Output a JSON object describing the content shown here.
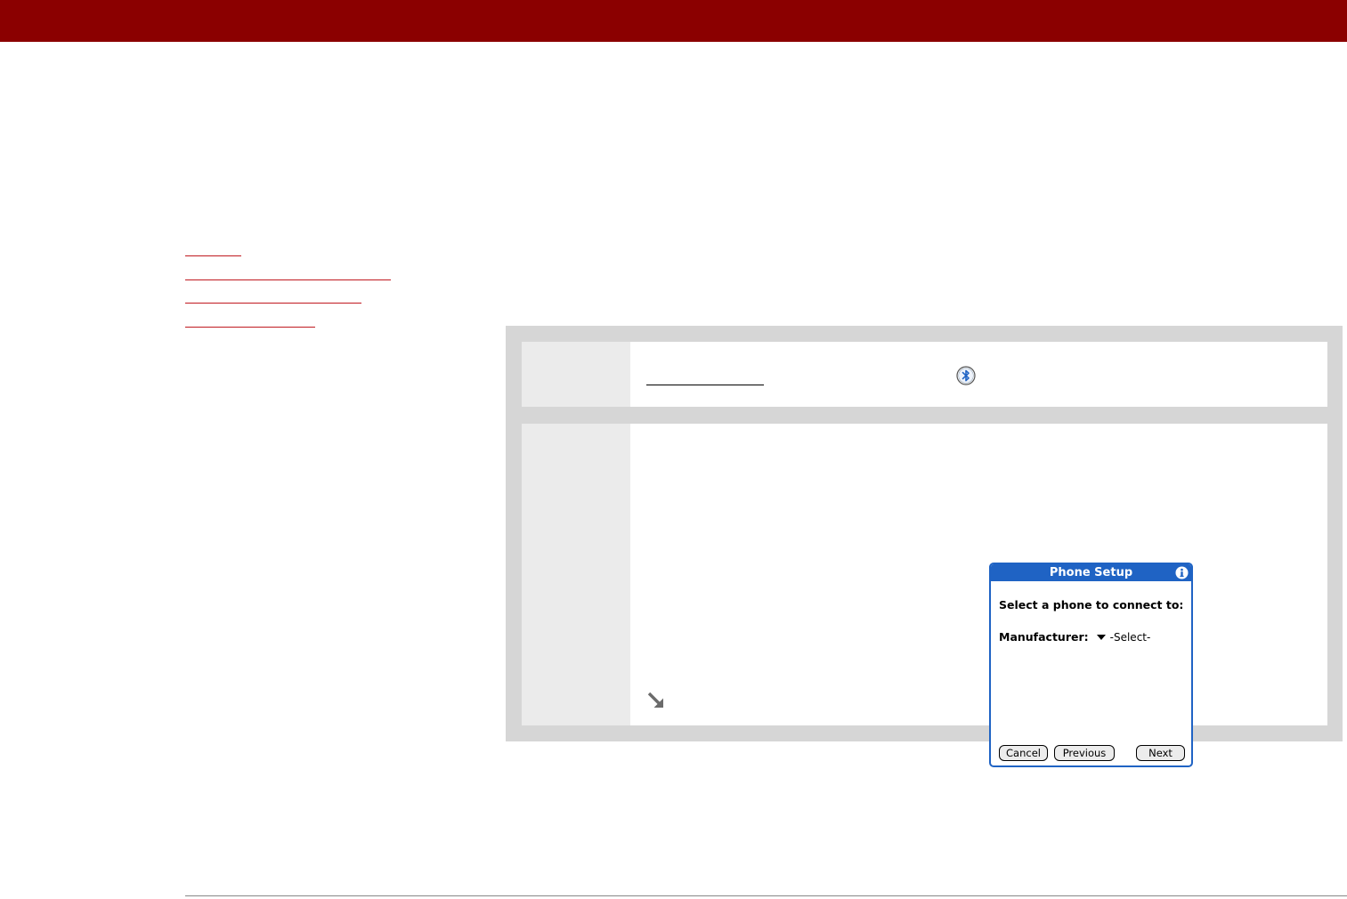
{
  "colors": {
    "brand": "#8b0000",
    "link": "#c0191f",
    "palm_blue": "#1f63c4"
  },
  "side_links": [
    {
      "name": "link-1",
      "width_hint": "short"
    },
    {
      "name": "link-2",
      "width_hint": "long"
    },
    {
      "name": "link-3",
      "width_hint": "medium"
    },
    {
      "name": "link-4",
      "width_hint": "short"
    }
  ],
  "icons": {
    "bluetooth": "bluetooth-icon",
    "tip_arrow": "arrow-down-right-icon",
    "info": "info-icon",
    "dropdown": "triangle-down-icon"
  },
  "phone_setup": {
    "title": "Phone Setup",
    "prompt": "Select a phone to connect to:",
    "manufacturer_label": "Manufacturer:",
    "manufacturer_value": "-Select-",
    "buttons": {
      "cancel": "Cancel",
      "previous": "Previous",
      "next": "Next"
    }
  }
}
